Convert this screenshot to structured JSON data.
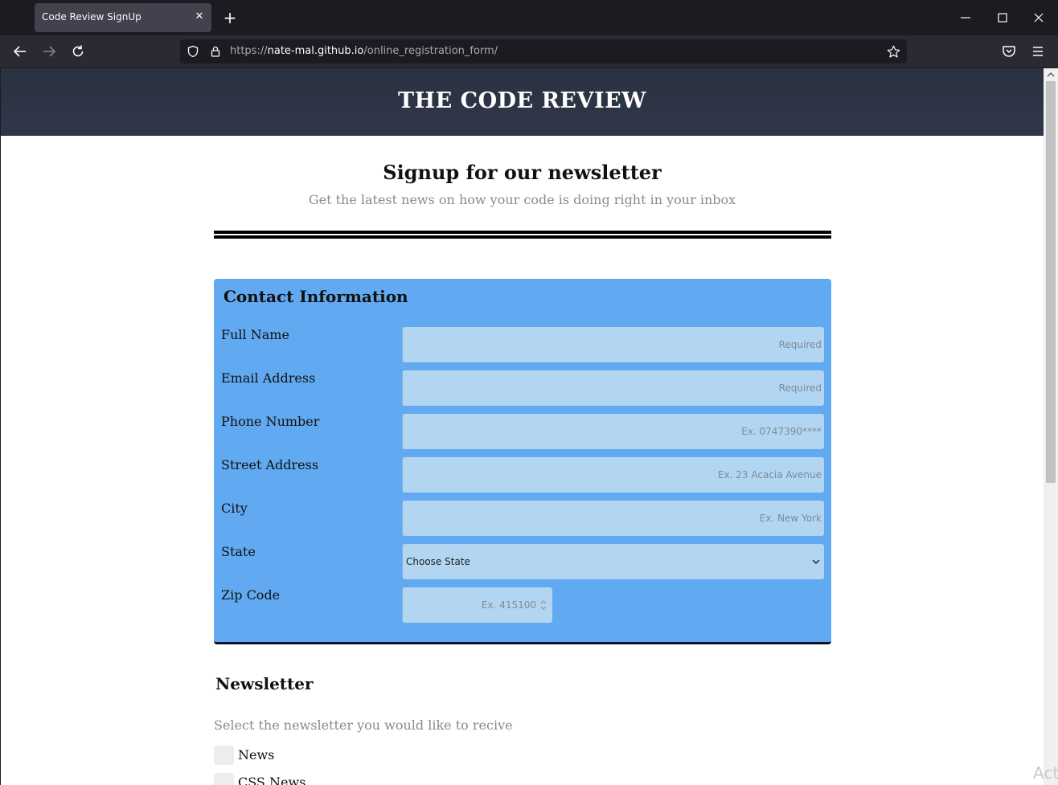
{
  "browser": {
    "tab_title": "Code Review SignUp",
    "tab_close": "✕",
    "new_tab": "+",
    "url_scheme": "https://",
    "url_host": "nate-mal.github.io",
    "url_path": "/online_registration_form/"
  },
  "header": {
    "site_title": "THE CODE REVIEW"
  },
  "hero": {
    "title": "Signup for our newsletter",
    "subtitle": "Get the latest news on how your code is doing right in your inbox"
  },
  "contact": {
    "title": "Contact Information",
    "fields": [
      {
        "label": "Full Name",
        "placeholder": "Required"
      },
      {
        "label": "Email Address",
        "placeholder": "Required"
      },
      {
        "label": "Phone Number",
        "placeholder": "Ex. 0747390****"
      },
      {
        "label": "Street Address",
        "placeholder": "Ex. 23 Acacia Avenue"
      },
      {
        "label": "City",
        "placeholder": "Ex. New York"
      },
      {
        "label": "State",
        "selected": "Choose State"
      },
      {
        "label": "Zip Code",
        "placeholder": "Ex. 415100"
      }
    ]
  },
  "newsletter": {
    "title": "Newsletter",
    "subtitle": "Select the newsletter you would like to recive",
    "options": [
      {
        "label": "News",
        "checked": false
      },
      {
        "label": "CSS News",
        "checked": false
      }
    ]
  },
  "overlay_text": "Act",
  "colors": {
    "header_bg": "#2f3749",
    "card_bg": "#61a9f0",
    "input_bg": "#b2d6f2"
  }
}
